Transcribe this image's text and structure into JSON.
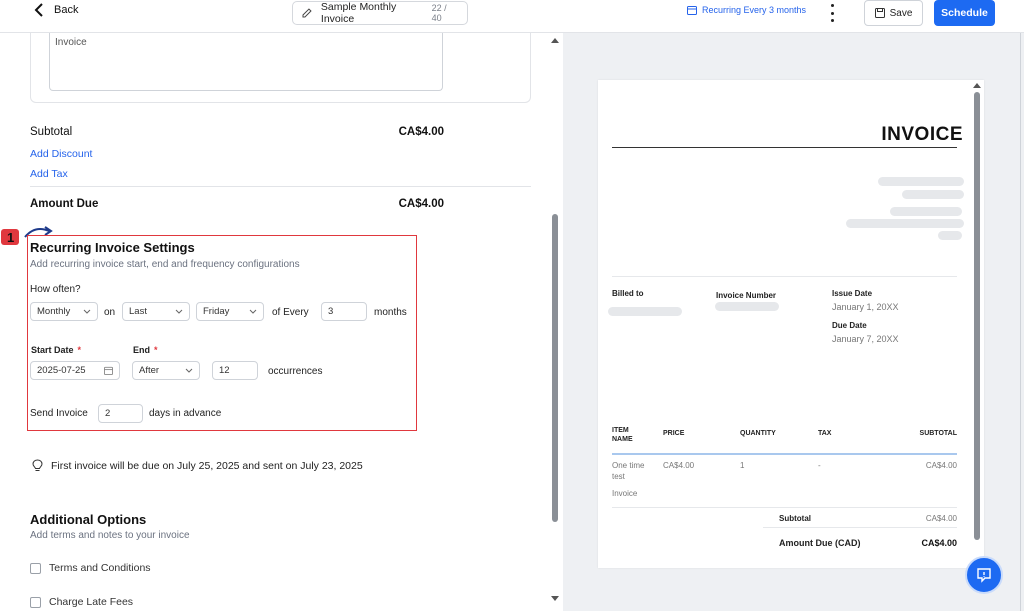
{
  "header": {
    "back_label": "Back",
    "invoice_title": "Sample Monthly Invoice",
    "title_count": "22 / 40",
    "recurring_label": "Recurring Every 3 months",
    "save_label": "Save",
    "schedule_label": "Schedule"
  },
  "editor": {
    "notes_value": "Invoice",
    "subtotal_label": "Subtotal",
    "subtotal_value": "CA$4.00",
    "add_discount": "Add Discount",
    "add_tax": "Add Tax",
    "amount_due_label": "Amount Due",
    "amount_due_value": "CA$4.00",
    "marker_number": "1",
    "recurring": {
      "title": "Recurring Invoice Settings",
      "subtitle": "Add recurring invoice start, end and frequency configurations",
      "how_often_label": "How often?",
      "frequency": "Monthly",
      "on_label": "on",
      "position": "Last",
      "weekday": "Friday",
      "of_every_label": "of Every",
      "interval": "3",
      "unit_label": "months",
      "start_date_label": "Start Date",
      "end_label": "End",
      "required_mark": "*",
      "start_date": "2025-07-25",
      "end_type": "After",
      "occurrences": "12",
      "occurrences_label": "occurrences",
      "send_invoice_label": "Send Invoice",
      "days_value": "2",
      "days_label": "days in advance"
    },
    "info_text": "First invoice will be due on July 25, 2025 and sent on July 23, 2025",
    "additional": {
      "title": "Additional Options",
      "subtitle": "Add terms and notes to your invoice",
      "terms_label": "Terms and Conditions",
      "late_fees_label": "Charge Late Fees"
    }
  },
  "preview": {
    "title": "INVOICE",
    "billed_to_label": "Billed to",
    "invoice_number_label": "Invoice Number",
    "issue_date_label": "Issue Date",
    "issue_date": "January 1, 20XX",
    "due_date_label": "Due Date",
    "due_date": "January 7, 20XX",
    "columns": {
      "item_name": "ITEM\nNAME",
      "price": "PRICE",
      "quantity": "QUANTITY",
      "tax": "TAX",
      "subtotal": "SUBTOTAL"
    },
    "row": {
      "name": "One time test",
      "desc": "Invoice",
      "price": "CA$4.00",
      "quantity": "1",
      "tax": "-",
      "subtotal": "CA$4.00"
    },
    "subtotal_label": "Subtotal",
    "subtotal_value": "CA$4.00",
    "amount_due_label": "Amount Due (CAD)",
    "amount_due_value": "CA$4.00"
  },
  "colors": {
    "accent": "#1d6af2",
    "highlight": "#e0383e"
  },
  "icons": [
    "back-arrow-icon",
    "edit-icon",
    "calendar-icon",
    "kebab-icon",
    "save-icon",
    "lightbulb-icon",
    "chat-icon"
  ]
}
